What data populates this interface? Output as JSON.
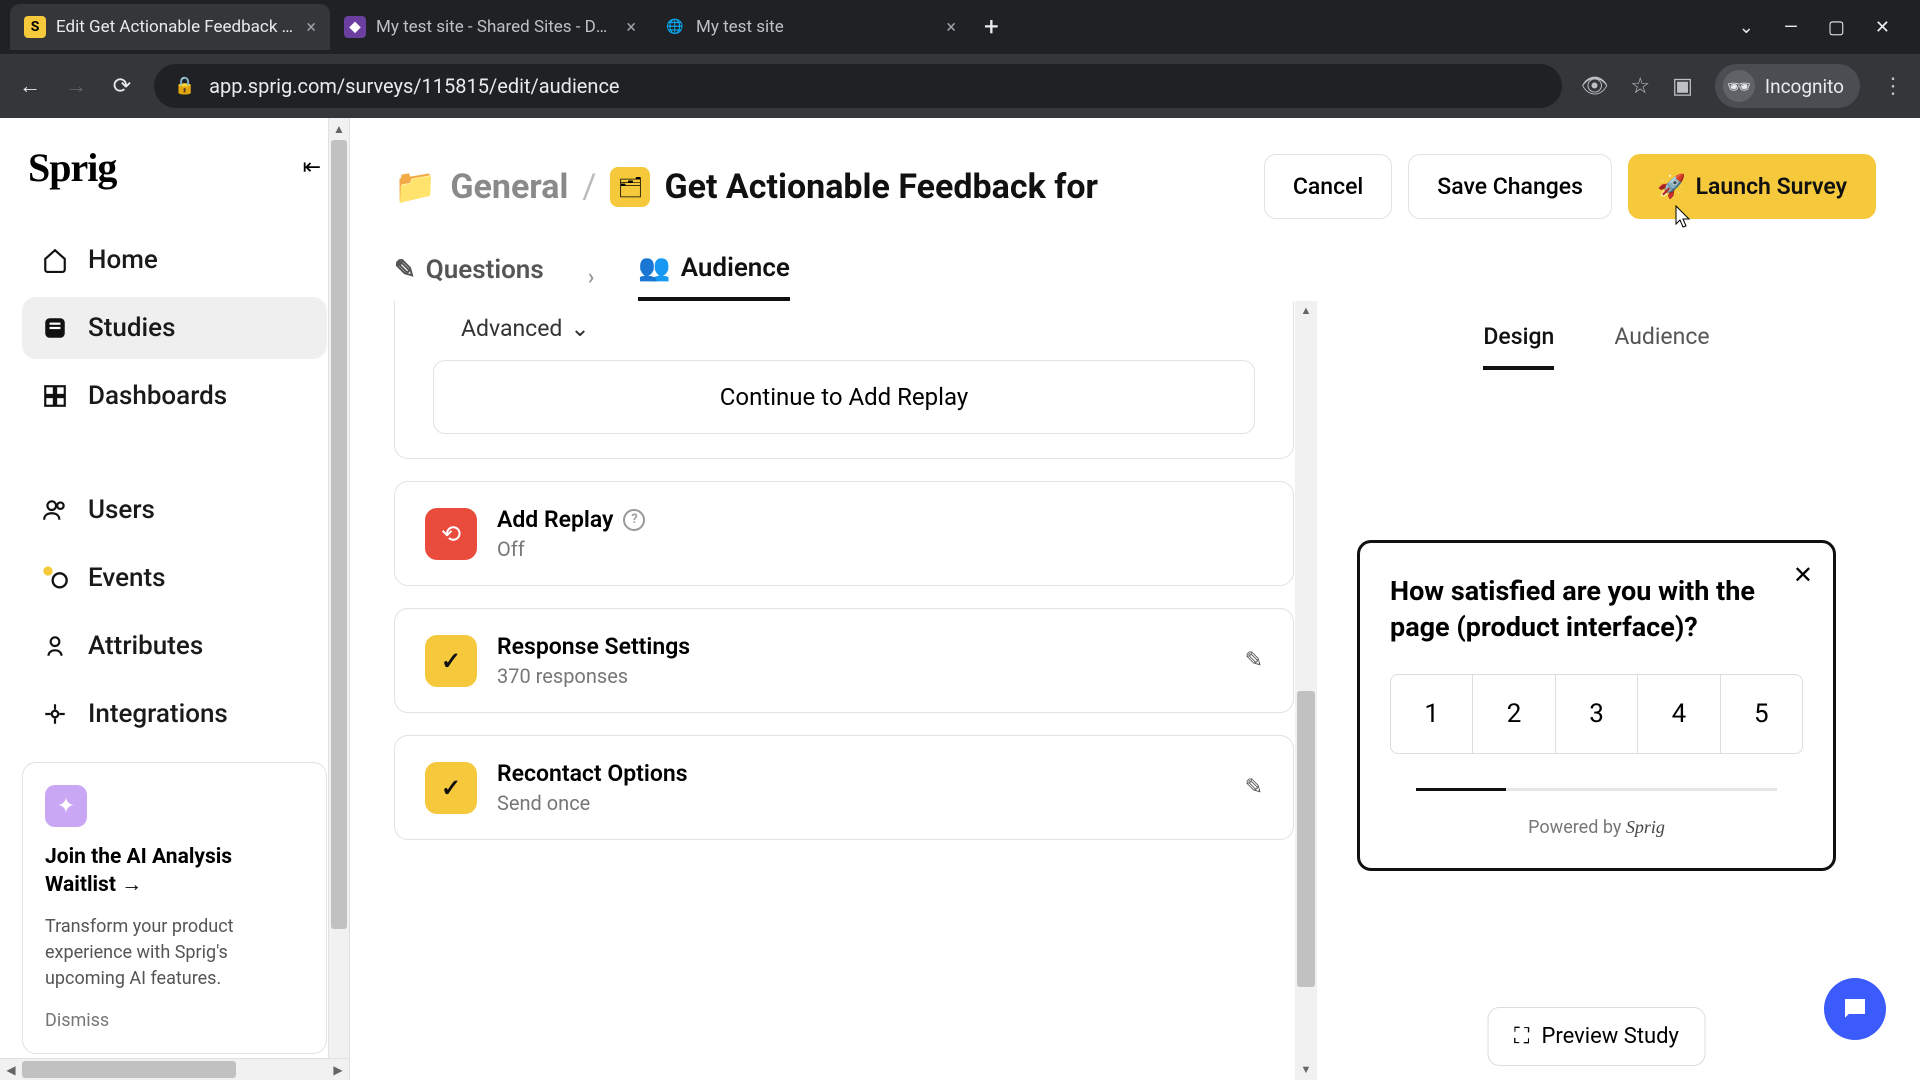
{
  "browser": {
    "tabs": [
      {
        "title": "Edit Get Actionable Feedback for",
        "favicon": "S",
        "kind": "sprig",
        "active": true
      },
      {
        "title": "My test site - Shared Sites - Dash",
        "favicon": "◆",
        "kind": "purple",
        "active": false
      },
      {
        "title": "My test site",
        "favicon": "🌐",
        "kind": "globe",
        "active": false
      }
    ],
    "url": "app.sprig.com/surveys/115815/edit/audience",
    "incognito_label": "Incognito"
  },
  "sidebar": {
    "logo": "Sprig",
    "items": [
      {
        "icon": "home",
        "label": "Home"
      },
      {
        "icon": "studies",
        "label": "Studies",
        "active": true
      },
      {
        "icon": "dashboards",
        "label": "Dashboards"
      }
    ],
    "items2": [
      {
        "icon": "users",
        "label": "Users"
      },
      {
        "icon": "events",
        "label": "Events"
      },
      {
        "icon": "attributes",
        "label": "Attributes"
      },
      {
        "icon": "integrations",
        "label": "Integrations"
      }
    ],
    "ai": {
      "title": "Join the AI Analysis Waitlist →",
      "body": "Transform your product experience with Sprig's upcoming AI features.",
      "dismiss": "Dismiss"
    }
  },
  "header": {
    "folder": "General",
    "title": "Get Actionable Feedback for",
    "cancel": "Cancel",
    "save": "Save Changes",
    "launch": "Launch Survey"
  },
  "tabs": {
    "questions": "Questions",
    "audience": "Audience"
  },
  "left": {
    "advanced": "Advanced",
    "continue": "Continue to Add Replay",
    "replay": {
      "title": "Add Replay",
      "sub": "Off"
    },
    "response": {
      "title": "Response Settings",
      "sub": "370 responses"
    },
    "recontact": {
      "title": "Recontact Options",
      "sub": "Send once"
    }
  },
  "preview": {
    "tab_design": "Design",
    "tab_audience": "Audience",
    "question": "How satisfied are you with the page (product interface)?",
    "scale": [
      "1",
      "2",
      "3",
      "4",
      "5"
    ],
    "powered": "Powered by ",
    "brand": "Sprig",
    "button": "Preview Study"
  }
}
